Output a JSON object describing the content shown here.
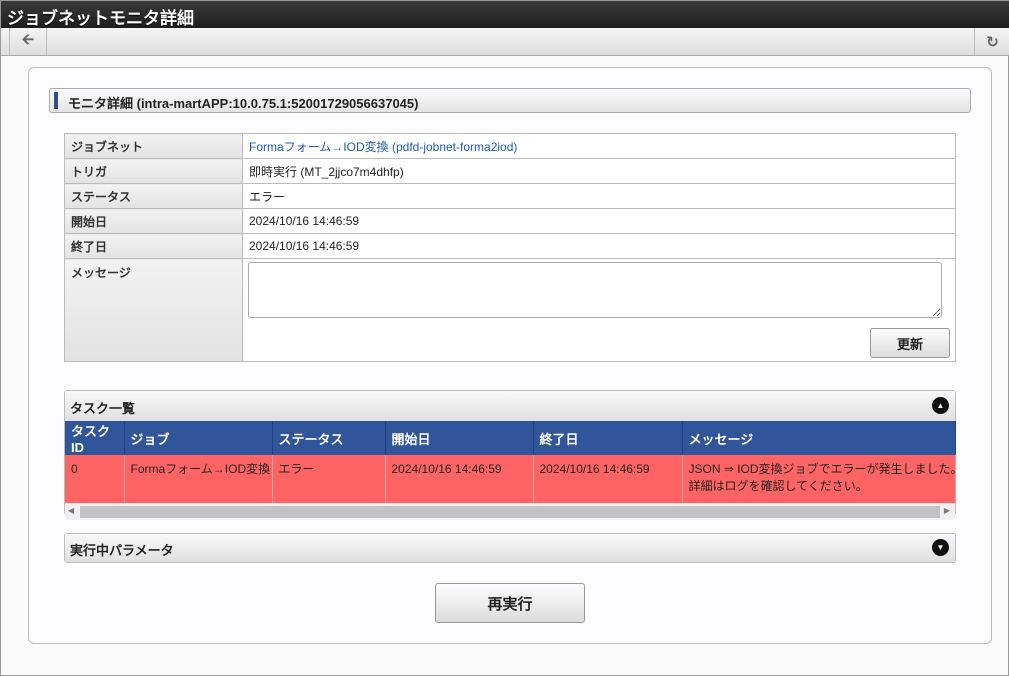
{
  "title": "ジョブネットモニタ詳細",
  "section_title": "モニタ詳細 (intra-martAPP:10.0.75.1:52001729056637045)",
  "info": {
    "jobnet_label": "ジョブネット",
    "jobnet_value": "Formaフォーム→IOD変換 (pdfd-jobnet-forma2iod)",
    "trigger_label": "トリガ",
    "trigger_value": "即時実行 (MT_2jjco7m4dhfp)",
    "status_label": "ステータス",
    "status_value": "エラー",
    "start_label": "開始日",
    "start_value": "2024/10/16 14:46:59",
    "end_label": "終了日",
    "end_value": "2024/10/16 14:46:59",
    "message_label": "メッセージ",
    "message_value": ""
  },
  "update_button": "更新",
  "tasks": {
    "title": "タスク一覧",
    "columns": [
      "タスクID",
      "ジョブ",
      "ステータス",
      "開始日",
      "終了日",
      "メッセージ"
    ],
    "rows": [
      {
        "id": "0",
        "job": "Formaフォーム→IOD変換",
        "status": "エラー",
        "start": "2024/10/16 14:46:59",
        "end": "2024/10/16 14:46:59",
        "message_line1": "JSON ⇒ IOD変換ジョブでエラーが発生しました。",
        "message_line2": "詳細はログを確認してください。"
      }
    ]
  },
  "params_title": "実行中パラメータ",
  "rerun_button": "再実行",
  "colors": {
    "header_blue": "#31559a",
    "error_row": "#ff6464"
  }
}
